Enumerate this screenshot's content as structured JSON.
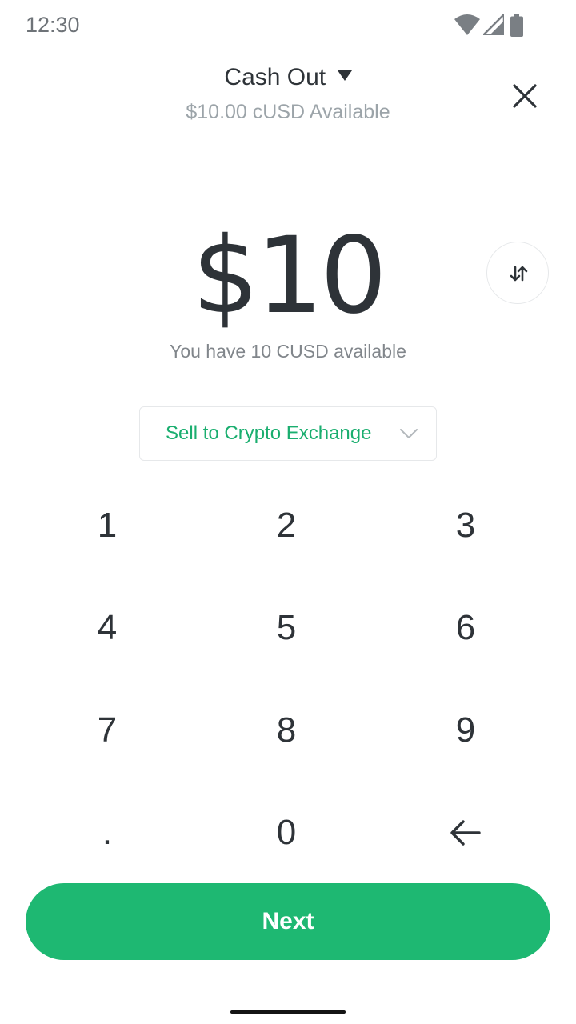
{
  "status_bar": {
    "time": "12:30",
    "icons": [
      "wifi-icon",
      "cellular-signal-icon",
      "battery-icon"
    ]
  },
  "header": {
    "title": "Cash Out",
    "subtitle": "$10.00 cUSD Available",
    "title_icon": "caret-down-icon",
    "close_icon": "close-icon"
  },
  "amount": {
    "display": "$10",
    "available_text": "You have 10 CUSD available",
    "swap_icon": "swap-arrows-icon"
  },
  "method_select": {
    "selected": "Sell to Crypto Exchange",
    "chevron_icon": "chevron-down-icon"
  },
  "keypad": {
    "keys": [
      "1",
      "2",
      "3",
      "4",
      "5",
      "6",
      "7",
      "8",
      "9",
      ".",
      "0"
    ],
    "backspace_icon": "backspace-arrow-icon"
  },
  "next_label": "Next",
  "colors": {
    "primary_green": "#1eb872",
    "accent_green_text": "#1aae6f",
    "text_dark": "#2e3338",
    "text_gray": "#81868b"
  }
}
